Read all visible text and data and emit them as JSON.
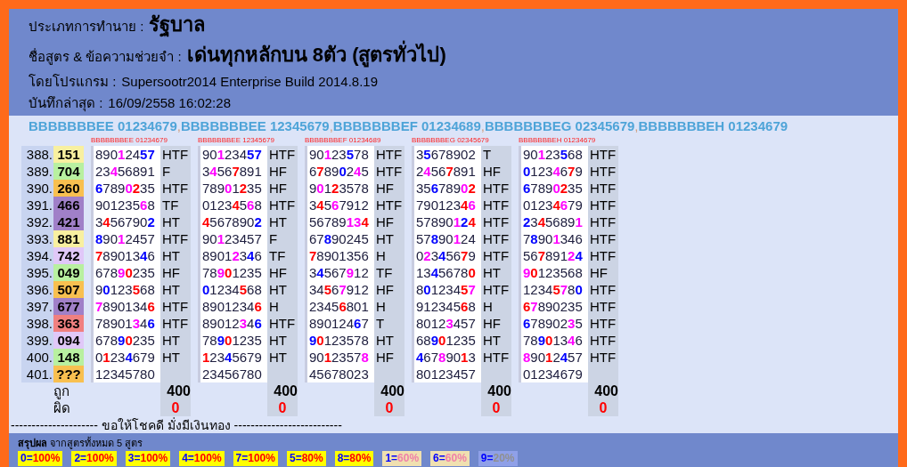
{
  "header": {
    "fields": [
      {
        "label": "ประเภทการทำนาย :",
        "value": "รัฐบาล",
        "kind": "large"
      },
      {
        "label": "ชื่อสูตร & ข้อความช่วยจำ :",
        "value": "เด่นทุกหลักบน 8ตัว (สูตรทั่วไป)",
        "kind": "large"
      },
      {
        "label": "โดยโปรแกรม :",
        "value": "Supersootr2014 Enterprise Build 2014.8.19",
        "kind": "normal"
      },
      {
        "label": "บันทึกล่าสุด :",
        "value": "16/09/2558 16:02:28",
        "kind": "normal"
      }
    ]
  },
  "formula_list": [
    {
      "name": "BBBBBBBEE 01234679"
    },
    {
      "separator": ",",
      "name": "BBBBBBBEE 12345679"
    },
    {
      "separator": ",",
      "name": "BBBBBBBEF 01234689"
    },
    {
      "separator": ",",
      "name": "BBBBBBBEG 02345679"
    },
    {
      "separator": ",",
      "name": "BBBBBBBEH 01234679"
    }
  ],
  "rows": [
    {
      "index": "388.",
      "result": "151",
      "color": "#f8f0a0"
    },
    {
      "index": "389.",
      "result": "704",
      "color": "#b8f0a0"
    },
    {
      "index": "390.",
      "result": "260",
      "color": "#f8c050"
    },
    {
      "index": "391.",
      "result": "466",
      "color": "#a080c8"
    },
    {
      "index": "392.",
      "result": "421",
      "color": "#a080c8"
    },
    {
      "index": "393.",
      "result": "881",
      "color": "#f8f0a0"
    },
    {
      "index": "394.",
      "result": "742",
      "color": "#e0c8f8"
    },
    {
      "index": "395.",
      "result": "049",
      "color": "#b8f0a0"
    },
    {
      "index": "396.",
      "result": "507",
      "color": "#f8c050"
    },
    {
      "index": "397.",
      "result": "677",
      "color": "#a080c8"
    },
    {
      "index": "398.",
      "result": "363",
      "color": "#f08080"
    },
    {
      "index": "399.",
      "result": "094",
      "color": "#e0c8f8"
    },
    {
      "index": "400.",
      "result": "148",
      "color": "#b8f0a0"
    },
    {
      "index": "401.",
      "result": "???",
      "color": "#f8c050"
    }
  ],
  "formulas": [
    {
      "header": "BBBBBBBEE 01234679",
      "correct": "400",
      "wrong": "0",
      "cells": [
        {
          "status": "HTF",
          "parts": [
            {
              "text": "890"
            },
            {
              "text": "1",
              "color": "#ff00ff"
            },
            {
              "text": "24"
            },
            {
              "text": "57",
              "color": "#0000ff"
            }
          ]
        },
        {
          "status": "F",
          "parts": [
            {
              "text": "23"
            },
            {
              "text": "4",
              "color": "#ff00ff"
            },
            {
              "text": "56891"
            }
          ]
        },
        {
          "status": "HTF",
          "parts": [
            {
              "text": "6",
              "color": "#0000ff"
            },
            {
              "text": "789"
            },
            {
              "text": "0",
              "color": "#ff00ff"
            },
            {
              "text": "2",
              "color": "#ff0000"
            },
            {
              "text": "35"
            }
          ]
        },
        {
          "status": "TF",
          "parts": [
            {
              "text": "901235"
            },
            {
              "text": "6",
              "color": "#ff00ff"
            },
            {
              "text": "8"
            }
          ]
        },
        {
          "status": "HT",
          "parts": [
            {
              "text": "3"
            },
            {
              "text": "4",
              "color": "#ff0000"
            },
            {
              "text": "56790"
            },
            {
              "text": "2",
              "color": "#0000ff"
            }
          ]
        },
        {
          "status": "HTF",
          "parts": [
            {
              "text": "8",
              "color": "#0000ff"
            },
            {
              "text": "90"
            },
            {
              "text": "1",
              "color": "#ff00ff"
            },
            {
              "text": "2457"
            }
          ]
        },
        {
          "status": "HT",
          "parts": [
            {
              "text": "7",
              "color": "#ff0000"
            },
            {
              "text": "89013"
            },
            {
              "text": "4",
              "color": "#0000ff"
            },
            {
              "text": "6"
            }
          ]
        },
        {
          "status": "HF",
          "parts": [
            {
              "text": "678"
            },
            {
              "text": "9",
              "color": "#ff00ff"
            },
            {
              "text": "0",
              "color": "#ff0000"
            },
            {
              "text": "235"
            }
          ]
        },
        {
          "status": "HT",
          "parts": [
            {
              "text": "9"
            },
            {
              "text": "0",
              "color": "#0000ff"
            },
            {
              "text": "123"
            },
            {
              "text": "5",
              "color": "#ff0000"
            },
            {
              "text": "68"
            }
          ]
        },
        {
          "status": "HTF",
          "parts": [
            {
              "text": "7",
              "color": "#ff00ff"
            },
            {
              "text": "890134"
            },
            {
              "text": "6",
              "color": "#ff0000"
            }
          ]
        },
        {
          "status": "HTF",
          "parts": [
            {
              "text": "78901"
            },
            {
              "text": "3",
              "color": "#ff00ff"
            },
            {
              "text": "4"
            },
            {
              "text": "6",
              "color": "#0000ff"
            }
          ]
        },
        {
          "status": "HT",
          "parts": [
            {
              "text": "678"
            },
            {
              "text": "9",
              "color": "#0000ff"
            },
            {
              "text": "0",
              "color": "#ff0000"
            },
            {
              "text": "235"
            }
          ]
        },
        {
          "status": "HT",
          "parts": [
            {
              "text": "0"
            },
            {
              "text": "1",
              "color": "#ff0000"
            },
            {
              "text": "23"
            },
            {
              "text": "4",
              "color": "#0000ff"
            },
            {
              "text": "679"
            }
          ]
        },
        {
          "parts": [
            {
              "text": "12345780"
            }
          ]
        }
      ]
    },
    {
      "header": "BBBBBBBEE 12345679",
      "correct": "400",
      "wrong": "0",
      "cells": [
        {
          "status": "HTF",
          "parts": [
            {
              "text": "90"
            },
            {
              "text": "1",
              "color": "#ff00ff"
            },
            {
              "text": "234"
            },
            {
              "text": "57",
              "color": "#0000ff"
            }
          ]
        },
        {
          "status": "HF",
          "parts": [
            {
              "text": "3"
            },
            {
              "text": "4",
              "color": "#ff00ff"
            },
            {
              "text": "56"
            },
            {
              "text": "7",
              "color": "#ff0000"
            },
            {
              "text": "891"
            }
          ]
        },
        {
          "status": "HF",
          "parts": [
            {
              "text": "789"
            },
            {
              "text": "0",
              "color": "#ff00ff"
            },
            {
              "text": "1"
            },
            {
              "text": "2",
              "color": "#ff0000"
            },
            {
              "text": "35"
            }
          ]
        },
        {
          "status": "HTF",
          "parts": [
            {
              "text": "0123"
            },
            {
              "text": "4",
              "color": "#ff0000"
            },
            {
              "text": "5"
            },
            {
              "text": "6",
              "color": "#ff00ff"
            },
            {
              "text": "8"
            }
          ]
        },
        {
          "status": "HT",
          "parts": [
            {
              "text": "4",
              "color": "#ff0000"
            },
            {
              "text": "567890"
            },
            {
              "text": "2",
              "color": "#0000ff"
            }
          ]
        },
        {
          "status": "F",
          "parts": [
            {
              "text": "90"
            },
            {
              "text": "1",
              "color": "#ff00ff"
            },
            {
              "text": "23457"
            }
          ]
        },
        {
          "status": "TF",
          "parts": [
            {
              "text": "8901"
            },
            {
              "text": "2",
              "color": "#ff00ff"
            },
            {
              "text": "3"
            },
            {
              "text": "4",
              "color": "#0000ff"
            },
            {
              "text": "6"
            }
          ]
        },
        {
          "status": "HF",
          "parts": [
            {
              "text": "78"
            },
            {
              "text": "9",
              "color": "#ff00ff"
            },
            {
              "text": "0",
              "color": "#ff0000"
            },
            {
              "text": "1235"
            }
          ]
        },
        {
          "status": "HT",
          "parts": [
            {
              "text": "0",
              "color": "#0000ff"
            },
            {
              "text": "1234"
            },
            {
              "text": "5",
              "color": "#ff0000"
            },
            {
              "text": "68"
            }
          ]
        },
        {
          "status": "H",
          "parts": [
            {
              "text": "8901234"
            },
            {
              "text": "6",
              "color": "#ff0000"
            }
          ]
        },
        {
          "status": "HTF",
          "parts": [
            {
              "text": "89012"
            },
            {
              "text": "3",
              "color": "#ff00ff"
            },
            {
              "text": "4"
            },
            {
              "text": "6",
              "color": "#0000ff"
            }
          ]
        },
        {
          "status": "HT",
          "parts": [
            {
              "text": "78"
            },
            {
              "text": "9",
              "color": "#0000ff"
            },
            {
              "text": "0",
              "color": "#ff0000"
            },
            {
              "text": "1235"
            }
          ]
        },
        {
          "status": "HT",
          "parts": [
            {
              "text": "1",
              "color": "#ff0000"
            },
            {
              "text": "23"
            },
            {
              "text": "4",
              "color": "#0000ff"
            },
            {
              "text": "5679"
            }
          ]
        },
        {
          "parts": [
            {
              "text": "23456780"
            }
          ]
        }
      ]
    },
    {
      "header": "BBBBBBBEF 01234689",
      "correct": "400",
      "wrong": "0",
      "cells": [
        {
          "status": "HTF",
          "parts": [
            {
              "text": "90"
            },
            {
              "text": "1",
              "color": "#ff00ff"
            },
            {
              "text": "23"
            },
            {
              "text": "5",
              "color": "#0000ff"
            },
            {
              "text": "78"
            }
          ]
        },
        {
          "status": "HTF",
          "parts": [
            {
              "text": "6"
            },
            {
              "text": "7",
              "color": "#ff0000"
            },
            {
              "text": "89"
            },
            {
              "text": "0",
              "color": "#0000ff"
            },
            {
              "text": "2"
            },
            {
              "text": "4",
              "color": "#ff00ff"
            },
            {
              "text": "5"
            }
          ]
        },
        {
          "status": "HF",
          "parts": [
            {
              "text": "9"
            },
            {
              "text": "0",
              "color": "#ff00ff"
            },
            {
              "text": "1"
            },
            {
              "text": "2",
              "color": "#ff0000"
            },
            {
              "text": "3578"
            }
          ]
        },
        {
          "status": "HTF",
          "parts": [
            {
              "text": "3"
            },
            {
              "text": "4",
              "color": "#ff0000"
            },
            {
              "text": "5"
            },
            {
              "text": "6",
              "color": "#ff00ff"
            },
            {
              "text": "7912"
            }
          ]
        },
        {
          "status": "HF",
          "parts": [
            {
              "text": "56789"
            },
            {
              "text": "13",
              "color": "#ff00ff"
            },
            {
              "text": "4",
              "color": "#ff0000"
            }
          ]
        },
        {
          "status": "HT",
          "parts": [
            {
              "text": "67"
            },
            {
              "text": "8",
              "color": "#0000ff"
            },
            {
              "text": "90245"
            }
          ]
        },
        {
          "status": "H",
          "parts": [
            {
              "text": "7",
              "color": "#ff0000"
            },
            {
              "text": "8901356"
            }
          ]
        },
        {
          "status": "TF",
          "parts": [
            {
              "text": "3"
            },
            {
              "text": "4",
              "color": "#0000ff"
            },
            {
              "text": "567"
            },
            {
              "text": "9",
              "color": "#ff00ff"
            },
            {
              "text": "12"
            }
          ]
        },
        {
          "status": "HF",
          "parts": [
            {
              "text": "34"
            },
            {
              "text": "5",
              "color": "#ff0000"
            },
            {
              "text": "6"
            },
            {
              "text": "7",
              "color": "#ff00ff"
            },
            {
              "text": "912"
            }
          ]
        },
        {
          "status": "H",
          "parts": [
            {
              "text": "2345"
            },
            {
              "text": "6",
              "color": "#ff0000"
            },
            {
              "text": "801"
            }
          ]
        },
        {
          "status": "T",
          "parts": [
            {
              "text": "890124"
            },
            {
              "text": "6",
              "color": "#0000ff"
            },
            {
              "text": "7"
            }
          ]
        },
        {
          "status": "HT",
          "parts": [
            {
              "text": "9",
              "color": "#0000ff"
            },
            {
              "text": "0",
              "color": "#ff0000"
            },
            {
              "text": "123578"
            }
          ]
        },
        {
          "status": "HF",
          "parts": [
            {
              "text": "90"
            },
            {
              "text": "1",
              "color": "#ff0000"
            },
            {
              "text": "2357"
            },
            {
              "text": "8",
              "color": "#ff00ff"
            }
          ]
        },
        {
          "parts": [
            {
              "text": "45678023"
            }
          ]
        }
      ]
    },
    {
      "header": "BBBBBBBEG 02345679",
      "correct": "400",
      "wrong": "0",
      "cells": [
        {
          "status": "T",
          "parts": [
            {
              "text": "3"
            },
            {
              "text": "5",
              "color": "#0000ff"
            },
            {
              "text": "678902"
            }
          ]
        },
        {
          "status": "HF",
          "parts": [
            {
              "text": "2"
            },
            {
              "text": "4",
              "color": "#ff00ff"
            },
            {
              "text": "56"
            },
            {
              "text": "7",
              "color": "#ff0000"
            },
            {
              "text": "891"
            }
          ]
        },
        {
          "status": "HTF",
          "parts": [
            {
              "text": "35"
            },
            {
              "text": "6",
              "color": "#0000ff"
            },
            {
              "text": "789"
            },
            {
              "text": "0",
              "color": "#ff00ff"
            },
            {
              "text": "2",
              "color": "#ff0000"
            }
          ]
        },
        {
          "status": "HTF",
          "parts": [
            {
              "text": "790123"
            },
            {
              "text": "4",
              "color": "#ff0000"
            },
            {
              "text": "6",
              "color": "#ff00ff"
            }
          ]
        },
        {
          "status": "HTF",
          "parts": [
            {
              "text": "57890"
            },
            {
              "text": "1",
              "color": "#ff00ff"
            },
            {
              "text": "2",
              "color": "#0000ff"
            },
            {
              "text": "4",
              "color": "#ff0000"
            }
          ]
        },
        {
          "status": "HTF",
          "parts": [
            {
              "text": "57"
            },
            {
              "text": "8",
              "color": "#0000ff"
            },
            {
              "text": "90"
            },
            {
              "text": "1",
              "color": "#ff00ff"
            },
            {
              "text": "24"
            }
          ]
        },
        {
          "status": "HTF",
          "parts": [
            {
              "text": "0"
            },
            {
              "text": "2",
              "color": "#ff00ff"
            },
            {
              "text": "3"
            },
            {
              "text": "4",
              "color": "#0000ff"
            },
            {
              "text": "56"
            },
            {
              "text": "7",
              "color": "#ff0000"
            },
            {
              "text": "9"
            }
          ]
        },
        {
          "status": "HT",
          "parts": [
            {
              "text": "13"
            },
            {
              "text": "4",
              "color": "#0000ff"
            },
            {
              "text": "5678"
            },
            {
              "text": "0",
              "color": "#ff0000"
            }
          ]
        },
        {
          "status": "HTF",
          "parts": [
            {
              "text": "8"
            },
            {
              "text": "0",
              "color": "#0000ff"
            },
            {
              "text": "1234"
            },
            {
              "text": "5",
              "color": "#ff0000"
            },
            {
              "text": "7",
              "color": "#ff00ff"
            }
          ]
        },
        {
          "status": "H",
          "parts": [
            {
              "text": "912345"
            },
            {
              "text": "6",
              "color": "#ff0000"
            },
            {
              "text": "8"
            }
          ]
        },
        {
          "status": "HF",
          "parts": [
            {
              "text": "8012"
            },
            {
              "text": "3",
              "color": "#ff00ff"
            },
            {
              "text": "457"
            }
          ]
        },
        {
          "status": "HT",
          "parts": [
            {
              "text": "68"
            },
            {
              "text": "9",
              "color": "#0000ff"
            },
            {
              "text": "0",
              "color": "#ff0000"
            },
            {
              "text": "1235"
            }
          ]
        },
        {
          "status": "HTF",
          "parts": [
            {
              "text": "4",
              "color": "#0000ff"
            },
            {
              "text": "67"
            },
            {
              "text": "8",
              "color": "#ff00ff"
            },
            {
              "text": "90"
            },
            {
              "text": "1",
              "color": "#ff0000"
            },
            {
              "text": "3"
            }
          ]
        },
        {
          "parts": [
            {
              "text": "80123457"
            }
          ]
        }
      ]
    },
    {
      "header": "BBBBBBBEH 01234679",
      "correct": "400",
      "wrong": "0",
      "cells": [
        {
          "status": "HTF",
          "parts": [
            {
              "text": "90"
            },
            {
              "text": "1",
              "color": "#ff00ff"
            },
            {
              "text": "23"
            },
            {
              "text": "5",
              "color": "#0000ff"
            },
            {
              "text": "68"
            }
          ]
        },
        {
          "status": "HTF",
          "parts": [
            {
              "text": "0",
              "color": "#0000ff"
            },
            {
              "text": "123"
            },
            {
              "text": "4",
              "color": "#ff00ff"
            },
            {
              "text": "6"
            },
            {
              "text": "7",
              "color": "#ff0000"
            },
            {
              "text": "9"
            }
          ]
        },
        {
          "status": "HTF",
          "parts": [
            {
              "text": "6",
              "color": "#0000ff"
            },
            {
              "text": "789"
            },
            {
              "text": "0",
              "color": "#ff00ff"
            },
            {
              "text": "2",
              "color": "#ff0000"
            },
            {
              "text": "35"
            }
          ]
        },
        {
          "status": "HTF",
          "parts": [
            {
              "text": "0123"
            },
            {
              "text": "4",
              "color": "#ff0000"
            },
            {
              "text": "6",
              "color": "#ff00ff"
            },
            {
              "text": "79"
            }
          ]
        },
        {
          "status": "HTF",
          "parts": [
            {
              "text": "2",
              "color": "#0000ff"
            },
            {
              "text": "3"
            },
            {
              "text": "4",
              "color": "#ff0000"
            },
            {
              "text": "5689"
            },
            {
              "text": "1",
              "color": "#ff00ff"
            }
          ]
        },
        {
          "status": "HTF",
          "parts": [
            {
              "text": "7"
            },
            {
              "text": "8",
              "color": "#0000ff"
            },
            {
              "text": "90"
            },
            {
              "text": "1",
              "color": "#ff00ff"
            },
            {
              "text": "346"
            }
          ]
        },
        {
          "status": "HTF",
          "parts": [
            {
              "text": "56"
            },
            {
              "text": "7",
              "color": "#ff0000"
            },
            {
              "text": "891"
            },
            {
              "text": "2",
              "color": "#ff00ff"
            },
            {
              "text": "4",
              "color": "#0000ff"
            }
          ]
        },
        {
          "status": "HF",
          "parts": [
            {
              "text": "9",
              "color": "#ff00ff"
            },
            {
              "text": "0",
              "color": "#ff0000"
            },
            {
              "text": "123568"
            }
          ]
        },
        {
          "status": "HTF",
          "parts": [
            {
              "text": "1234"
            },
            {
              "text": "5",
              "color": "#ff0000"
            },
            {
              "text": "7",
              "color": "#ff00ff"
            },
            {
              "text": "8"
            },
            {
              "text": "0",
              "color": "#0000ff"
            }
          ]
        },
        {
          "status": "HTF",
          "parts": [
            {
              "text": "6",
              "color": "#ff0000"
            },
            {
              "text": "7",
              "color": "#ff00ff"
            },
            {
              "text": "890235"
            }
          ]
        },
        {
          "status": "HTF",
          "parts": [
            {
              "text": "6",
              "color": "#0000ff"
            },
            {
              "text": "78902"
            },
            {
              "text": "3",
              "color": "#ff00ff"
            },
            {
              "text": "5"
            }
          ]
        },
        {
          "status": "HTF",
          "parts": [
            {
              "text": "78"
            },
            {
              "text": "9",
              "color": "#0000ff"
            },
            {
              "text": "0",
              "color": "#ff0000"
            },
            {
              "text": "13"
            },
            {
              "text": "4",
              "color": "#ff00ff"
            },
            {
              "text": "6"
            }
          ]
        },
        {
          "status": "HTF",
          "parts": [
            {
              "text": "8",
              "color": "#ff00ff"
            },
            {
              "text": "90"
            },
            {
              "text": "1",
              "color": "#ff0000"
            },
            {
              "text": "2"
            },
            {
              "text": "4",
              "color": "#0000ff"
            },
            {
              "text": "57"
            }
          ]
        },
        {
          "parts": [
            {
              "text": "01234679"
            }
          ]
        }
      ]
    }
  ],
  "totals_labels": {
    "correct": "ถูก",
    "wrong": "ผิด"
  },
  "divider_text": "--------------------- ขอให้โชคดี มั่งมีเงินทอง --------------------------",
  "summary": {
    "title": "**สรุปผล** จากสูตรทั้งหมด 5 สูตร",
    "badges": [
      {
        "key": "0=",
        "value": "100%",
        "kind": "high"
      },
      {
        "key": "2=",
        "value": "100%",
        "kind": "high"
      },
      {
        "key": "3=",
        "value": "100%",
        "kind": "high"
      },
      {
        "key": "4=",
        "value": "100%",
        "kind": "high"
      },
      {
        "key": "7=",
        "value": "100%",
        "kind": "high"
      },
      {
        "key": "5=",
        "value": "80%",
        "kind": "high"
      },
      {
        "key": "8=",
        "value": "80%",
        "kind": "high"
      },
      {
        "key": "1=",
        "value": "60%",
        "kind": "mid"
      },
      {
        "key": "6=",
        "value": "60%",
        "kind": "mid"
      },
      {
        "key": "9=",
        "value": "20%",
        "kind": "low"
      }
    ]
  }
}
